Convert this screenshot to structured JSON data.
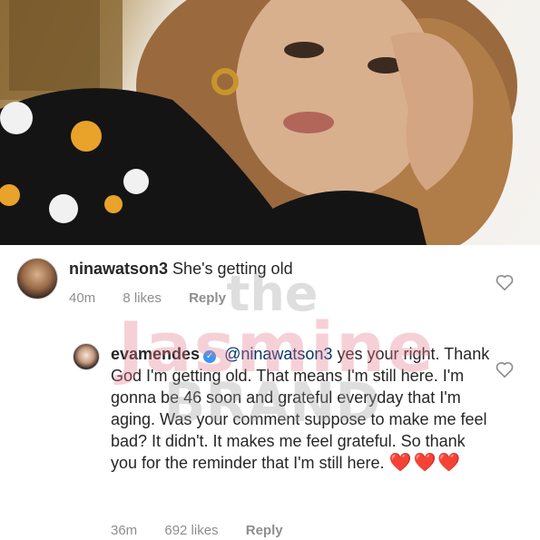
{
  "comments": [
    {
      "username": "ninawatson3",
      "text": "She's getting old",
      "time": "40m",
      "likes": "8 likes",
      "reply": "Reply"
    },
    {
      "username": "evamendes",
      "verified": true,
      "mention": "@ninawatson3",
      "text": "yes your right. Thank God I'm getting old. That means I'm still here. I'm gonna be 46 soon and grateful everyday that I'm aging. Was your comment suppose to make me feel bad? It didn't. It makes me feel grateful. So thank you for the reminder that I'm still here.",
      "emoji": "❤️❤️❤️",
      "time": "36m",
      "likes": "692 likes",
      "reply": "Reply"
    }
  ],
  "watermark": {
    "line1": "the",
    "line2": "Jasmine",
    "line3": "BRAND"
  },
  "icons": {
    "like": "heart-outline-icon",
    "verified": "verified-badge-icon"
  },
  "colors": {
    "verified": "#3897f0",
    "meta": "#8e8e8e",
    "heart": "#e0242c"
  }
}
